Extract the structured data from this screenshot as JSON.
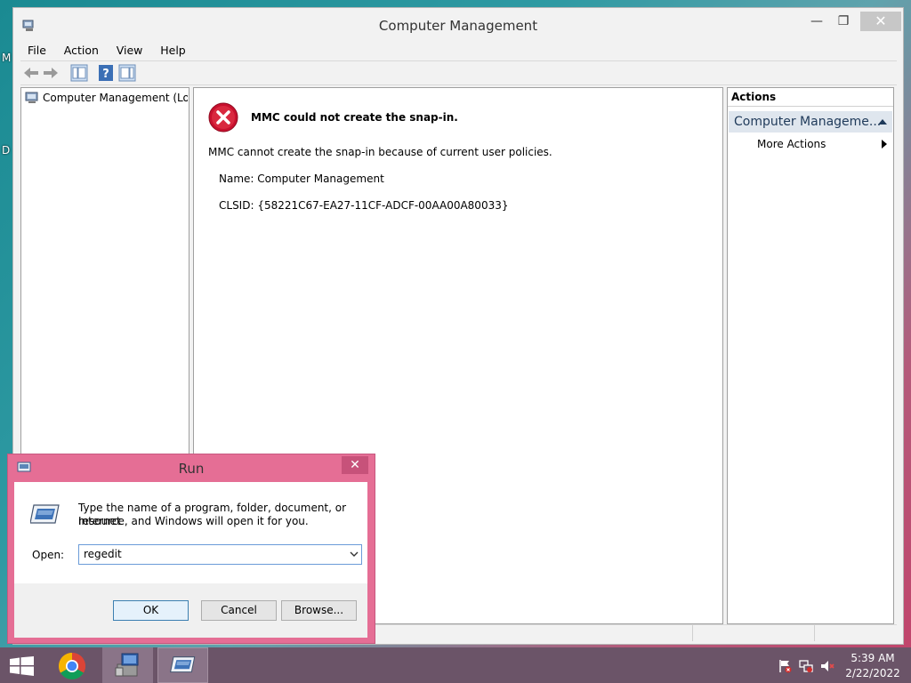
{
  "desktop": {
    "edge_letters": [
      "M",
      "D"
    ]
  },
  "mmc": {
    "title": "Computer Management",
    "menu": [
      "File",
      "Action",
      "View",
      "Help"
    ],
    "tree": {
      "root_label": "Computer Management (Local"
    },
    "error": {
      "title": "MMC could not create the snap-in.",
      "message": "MMC cannot create the snap-in because of current user policies.",
      "name_line": "Name: Computer Management",
      "clsid_line": "CLSID: {58221C67-EA27-11CF-ADCF-00AA00A80033}"
    },
    "actions": {
      "header": "Actions",
      "group_label": "Computer Manageme...",
      "more_actions": "More Actions"
    }
  },
  "run": {
    "title": "Run",
    "description_line1": "Type the name of a program, folder, document, or Internet",
    "description_line2": "resource, and Windows will open it for you.",
    "open_label": "Open:",
    "open_value": "regedit",
    "ok_label": "OK",
    "cancel_label": "Cancel",
    "browse_label": "Browse..."
  },
  "taskbar": {
    "apps": [
      "start",
      "chrome",
      "computer-management",
      "run"
    ],
    "time": "5:39 AM",
    "date": "2/22/2022"
  },
  "colors": {
    "run_frame": "#e56e95",
    "error_red": "#c8102e",
    "taskbar": "#6b5468"
  }
}
